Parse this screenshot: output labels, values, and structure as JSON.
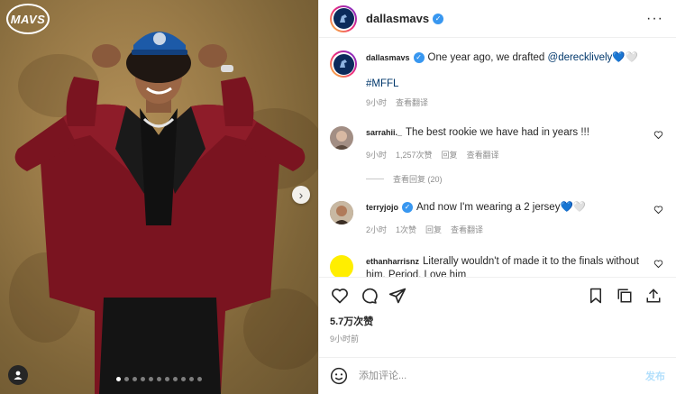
{
  "media": {
    "logo_text": "MAVS",
    "dots_total": 11,
    "dots_active": 0
  },
  "header": {
    "username": "dallasmavs",
    "verified": true,
    "more_icon": "more-horizontal-icon"
  },
  "caption": {
    "username": "dallasmavs",
    "text_before": "One year ago, we drafted ",
    "mention": "@derecklively",
    "emojis": "💙🤍",
    "hashtag": "#MFFL",
    "time": "9小时",
    "translate": "查看翻译"
  },
  "comments": [
    {
      "username": "sarrahii._",
      "text": "The best rookie we have had in years !!!",
      "time": "9小时",
      "likes": "1,257次赞",
      "reply": "回复",
      "translate": "查看翻译",
      "view_replies": "查看回复 (20)"
    },
    {
      "username": "terryjojo",
      "verified": true,
      "text": "And now I'm wearing a 2 jersey💙🤍",
      "time": "2小时",
      "likes": "1次赞",
      "reply": "回复",
      "translate": "查看翻译"
    },
    {
      "username": "ethanharrisnz",
      "text": "Literally wouldn't of made it to the finals without him. Period. Love him"
    }
  ],
  "actions": {
    "like_icon": "heart-icon",
    "comment_icon": "comment-icon",
    "share_icon": "send-icon",
    "save_icon": "bookmark-icon",
    "repost_icon": "copy-icon",
    "upload_icon": "upload-icon"
  },
  "stats": {
    "likes": "5.7万次赞",
    "age": "9小时前"
  },
  "add_comment": {
    "placeholder": "添加评论...",
    "post_label": "发布"
  },
  "colors": {
    "accent": "#3897f0",
    "link": "#00376b",
    "muted": "#8e8e8e"
  }
}
